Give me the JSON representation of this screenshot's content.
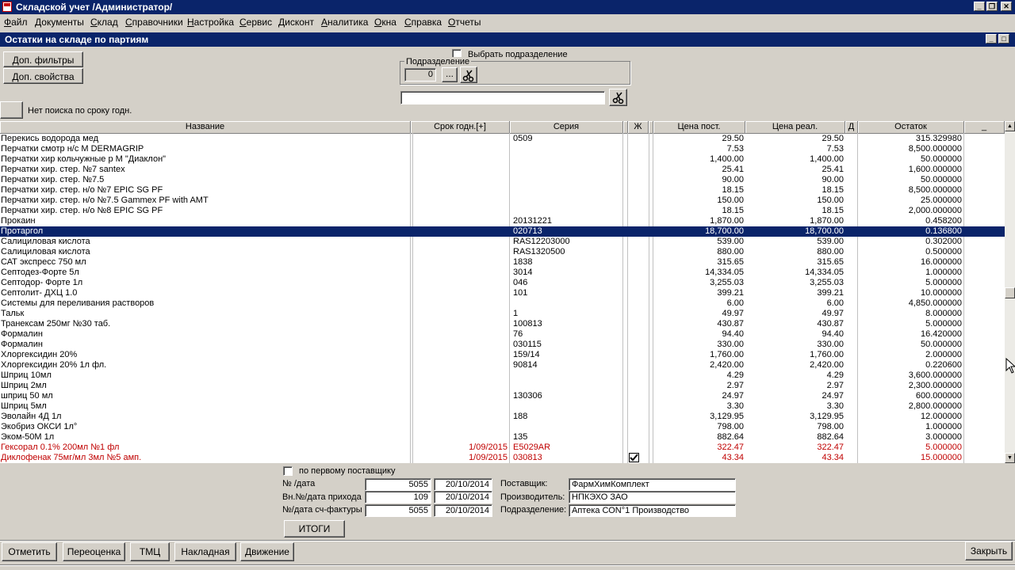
{
  "window": {
    "title": "Складской учет /Администратор/"
  },
  "menu": [
    "Файл",
    "Документы",
    "Склад",
    "Справочники",
    "Настройка",
    "Сервис",
    "Дисконт",
    "Аналитика",
    "Окна",
    "Справка",
    "Отчеты"
  ],
  "child_window": {
    "title": "Остатки на складе по партиям"
  },
  "filters": {
    "extra_filters": "Доп. фильтры",
    "extra_props": "Доп. свойства",
    "select_division": "Выбрать подразделение",
    "division_group": "Подразделение",
    "division_value": "0",
    "ellipsis": "...",
    "expiry_toggle_text": "Нет поиска по сроку годн."
  },
  "grid": {
    "columns": [
      "Название",
      "Срок годн.[+]",
      "Серия",
      "Ж",
      "Цена пост.",
      "Цена реал.",
      "Д",
      "Остаток",
      "_"
    ],
    "rows": [
      {
        "name": "Перекись водорода мед",
        "expiry": "",
        "series": "0509",
        "zh": false,
        "price_in": "29.50",
        "price_out": "29.50",
        "rest": "315.329980",
        "style": ""
      },
      {
        "name": "Перчатки смотр н/с M DERMAGRIP",
        "expiry": "",
        "series": "",
        "zh": false,
        "price_in": "7.53",
        "price_out": "7.53",
        "rest": "8,500.000000",
        "style": ""
      },
      {
        "name": "Перчатки хир кольчужные р M \"Диаклон\"",
        "expiry": "",
        "series": "",
        "zh": false,
        "price_in": "1,400.00",
        "price_out": "1,400.00",
        "rest": "50.000000",
        "style": ""
      },
      {
        "name": "Перчатки хир. стер. №7  santex",
        "expiry": "",
        "series": "",
        "zh": false,
        "price_in": "25.41",
        "price_out": "25.41",
        "rest": "1,600.000000",
        "style": ""
      },
      {
        "name": "Перчатки хир. стер. №7.5",
        "expiry": "",
        "series": "",
        "zh": false,
        "price_in": "90.00",
        "price_out": "90.00",
        "rest": "50.000000",
        "style": ""
      },
      {
        "name": "Перчатки хир. стер. н/о №7 EPIC SG PF",
        "expiry": "",
        "series": "",
        "zh": false,
        "price_in": "18.15",
        "price_out": "18.15",
        "rest": "8,500.000000",
        "style": ""
      },
      {
        "name": "Перчатки хир. стер. н/о №7.5 Gammex PF with AMT",
        "expiry": "",
        "series": "",
        "zh": false,
        "price_in": "150.00",
        "price_out": "150.00",
        "rest": "25.000000",
        "style": ""
      },
      {
        "name": "Перчатки хир. стер. н/о №8 EPIC SG PF",
        "expiry": "",
        "series": "",
        "zh": false,
        "price_in": "18.15",
        "price_out": "18.15",
        "rest": "2,000.000000",
        "style": ""
      },
      {
        "name": "Прокаин",
        "expiry": "",
        "series": "20131221",
        "zh": false,
        "price_in": "1,870.00",
        "price_out": "1,870.00",
        "rest": "0.458200",
        "style": ""
      },
      {
        "name": "Протаргол",
        "expiry": "",
        "series": "020713",
        "zh": false,
        "price_in": "18,700.00",
        "price_out": "18,700.00",
        "rest": "0.136800",
        "style": "sel"
      },
      {
        "name": "Салициловая кислота",
        "expiry": "",
        "series": "RAS12203000",
        "zh": false,
        "price_in": "539.00",
        "price_out": "539.00",
        "rest": "0.302000",
        "style": ""
      },
      {
        "name": "Салициловая кислота",
        "expiry": "",
        "series": "RAS1320500",
        "zh": false,
        "price_in": "880.00",
        "price_out": "880.00",
        "rest": "0.500000",
        "style": ""
      },
      {
        "name": "САТ экспресс 750 мл",
        "expiry": "",
        "series": "1838",
        "zh": false,
        "price_in": "315.65",
        "price_out": "315.65",
        "rest": "16.000000",
        "style": ""
      },
      {
        "name": "Септодез-Форте 5л",
        "expiry": "",
        "series": "3014",
        "zh": false,
        "price_in": "14,334.05",
        "price_out": "14,334.05",
        "rest": "1.000000",
        "style": ""
      },
      {
        "name": "Септодор- Форте 1л",
        "expiry": "",
        "series": "046",
        "zh": false,
        "price_in": "3,255.03",
        "price_out": "3,255.03",
        "rest": "5.000000",
        "style": ""
      },
      {
        "name": "Септолит- ДХЦ 1.0",
        "expiry": "",
        "series": "101",
        "zh": false,
        "price_in": "399.21",
        "price_out": "399.21",
        "rest": "10.000000",
        "style": ""
      },
      {
        "name": "Системы для переливания растворов",
        "expiry": "",
        "series": "",
        "zh": false,
        "price_in": "6.00",
        "price_out": "6.00",
        "rest": "4,850.000000",
        "style": ""
      },
      {
        "name": "Тальк",
        "expiry": "",
        "series": "1",
        "zh": false,
        "price_in": "49.97",
        "price_out": "49.97",
        "rest": "8.000000",
        "style": ""
      },
      {
        "name": "Транексам 250мг №30 таб.",
        "expiry": "",
        "series": "100813",
        "zh": false,
        "price_in": "430.87",
        "price_out": "430.87",
        "rest": "5.000000",
        "style": ""
      },
      {
        "name": "Формалин",
        "expiry": "",
        "series": "76",
        "zh": false,
        "price_in": "94.40",
        "price_out": "94.40",
        "rest": "16.420000",
        "style": ""
      },
      {
        "name": "Формалин",
        "expiry": "",
        "series": "030115",
        "zh": false,
        "price_in": "330.00",
        "price_out": "330.00",
        "rest": "50.000000",
        "style": ""
      },
      {
        "name": "Хлоргексидин 20%",
        "expiry": "",
        "series": "159/14",
        "zh": false,
        "price_in": "1,760.00",
        "price_out": "1,760.00",
        "rest": "2.000000",
        "style": ""
      },
      {
        "name": "Хлоргексидин 20% 1л фл.",
        "expiry": "",
        "series": "90814",
        "zh": false,
        "price_in": "2,420.00",
        "price_out": "2,420.00",
        "rest": "0.220600",
        "style": ""
      },
      {
        "name": "Шприц 10мл",
        "expiry": "",
        "series": "",
        "zh": false,
        "price_in": "4.29",
        "price_out": "4.29",
        "rest": "3,600.000000",
        "style": ""
      },
      {
        "name": "Шприц 2мл",
        "expiry": "",
        "series": "",
        "zh": false,
        "price_in": "2.97",
        "price_out": "2.97",
        "rest": "2,300.000000",
        "style": ""
      },
      {
        "name": "шприц 50 мл",
        "expiry": "",
        "series": "130306",
        "zh": false,
        "price_in": "24.97",
        "price_out": "24.97",
        "rest": "600.000000",
        "style": ""
      },
      {
        "name": "Шприц 5мл",
        "expiry": "",
        "series": "",
        "zh": false,
        "price_in": "3.30",
        "price_out": "3.30",
        "rest": "2,800.000000",
        "style": ""
      },
      {
        "name": "Эволайн 4Д 1л",
        "expiry": "",
        "series": "188",
        "zh": false,
        "price_in": "3,129.95",
        "price_out": "3,129.95",
        "rest": "12.000000",
        "style": ""
      },
      {
        "name": "Экобриз ОКСИ 1л°",
        "expiry": "",
        "series": "",
        "zh": false,
        "price_in": "798.00",
        "price_out": "798.00",
        "rest": "1.000000",
        "style": ""
      },
      {
        "name": "Эком-50М 1л",
        "expiry": "",
        "series": "135",
        "zh": false,
        "price_in": "882.64",
        "price_out": "882.64",
        "rest": "3.000000",
        "style": ""
      },
      {
        "name": "Гексорал 0.1% 200мл №1 фл",
        "expiry": "1/09/2015",
        "series": "E5029AR",
        "zh": false,
        "price_in": "322.47",
        "price_out": "322.47",
        "rest": "5.000000",
        "style": "red"
      },
      {
        "name": "Диклофенак 75мг/мл 3мл №5 амп.",
        "expiry": "1/09/2015",
        "series": "030813",
        "zh": true,
        "price_in": "43.34",
        "price_out": "43.34",
        "rest": "15.000000",
        "style": "red"
      }
    ]
  },
  "details": {
    "first_supplier": "по первому поставщику",
    "doc_label": "№ /дата",
    "doc_no": "5055",
    "doc_date": "20/10/2014",
    "inner_label": "Вн.№/дата прихода",
    "inner_no": "109",
    "inner_date": "20/10/2014",
    "invoice_label": "№/дата сч-фактуры",
    "invoice_no": "5055",
    "invoice_date": "20/10/2014",
    "supplier_label": "Поставщик:",
    "supplier": "ФармХимКомплект",
    "maker_label": "Производитель:",
    "maker": "НПКЭХО ЗАО",
    "division_label": "Подразделение:",
    "division": "Аптека СОN°1 Производство",
    "totals_btn": "ИТОГИ"
  },
  "bottom_buttons": [
    "Отметить",
    "Переоценка",
    "ТМЦ",
    "Накладная",
    "Движение"
  ],
  "close_btn": "Закрыть"
}
